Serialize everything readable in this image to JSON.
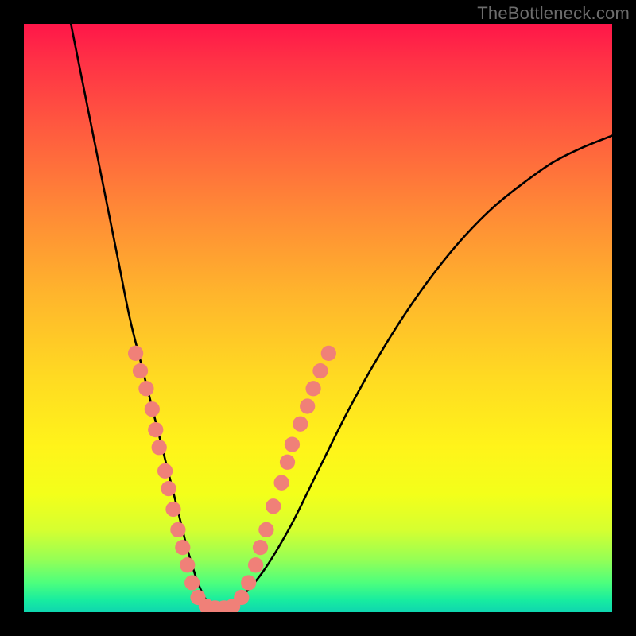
{
  "watermark": "TheBottleneck.com",
  "chart_data": {
    "type": "line",
    "title": "",
    "xlabel": "",
    "ylabel": "",
    "xlim": [
      0,
      100
    ],
    "ylim": [
      0,
      100
    ],
    "grid": false,
    "series": [
      {
        "name": "bottleneck-curve",
        "color": "#000000",
        "x": [
          8,
          10,
          12,
          14,
          16,
          18,
          20,
          22,
          24,
          26,
          28,
          30,
          32,
          35,
          40,
          45,
          50,
          55,
          60,
          65,
          70,
          75,
          80,
          85,
          90,
          95,
          100
        ],
        "y": [
          100,
          90,
          80,
          70,
          60,
          50,
          42,
          34,
          26,
          18,
          10,
          4,
          1,
          1,
          6,
          14,
          24,
          34,
          43,
          51,
          58,
          64,
          69,
          73,
          76.5,
          79,
          81
        ]
      }
    ],
    "markers": {
      "name": "highlight-dots",
      "color": "#f08078",
      "radius": 1.3,
      "points": [
        {
          "x": 19.0,
          "y": 44.0
        },
        {
          "x": 19.8,
          "y": 41.0
        },
        {
          "x": 20.8,
          "y": 38.0
        },
        {
          "x": 21.8,
          "y": 34.5
        },
        {
          "x": 22.4,
          "y": 31.0
        },
        {
          "x": 23.0,
          "y": 28.0
        },
        {
          "x": 24.0,
          "y": 24.0
        },
        {
          "x": 24.6,
          "y": 21.0
        },
        {
          "x": 25.4,
          "y": 17.5
        },
        {
          "x": 26.2,
          "y": 14.0
        },
        {
          "x": 27.0,
          "y": 11.0
        },
        {
          "x": 27.8,
          "y": 8.0
        },
        {
          "x": 28.6,
          "y": 5.0
        },
        {
          "x": 29.6,
          "y": 2.5
        },
        {
          "x": 31.0,
          "y": 1.0
        },
        {
          "x": 32.5,
          "y": 0.7
        },
        {
          "x": 34.0,
          "y": 0.7
        },
        {
          "x": 35.5,
          "y": 1.0
        },
        {
          "x": 37.0,
          "y": 2.5
        },
        {
          "x": 38.2,
          "y": 5.0
        },
        {
          "x": 39.4,
          "y": 8.0
        },
        {
          "x": 40.2,
          "y": 11.0
        },
        {
          "x": 41.2,
          "y": 14.0
        },
        {
          "x": 42.4,
          "y": 18.0
        },
        {
          "x": 43.8,
          "y": 22.0
        },
        {
          "x": 44.8,
          "y": 25.5
        },
        {
          "x": 45.6,
          "y": 28.5
        },
        {
          "x": 47.0,
          "y": 32.0
        },
        {
          "x": 48.2,
          "y": 35.0
        },
        {
          "x": 49.2,
          "y": 38.0
        },
        {
          "x": 50.4,
          "y": 41.0
        },
        {
          "x": 51.8,
          "y": 44.0
        }
      ]
    }
  }
}
